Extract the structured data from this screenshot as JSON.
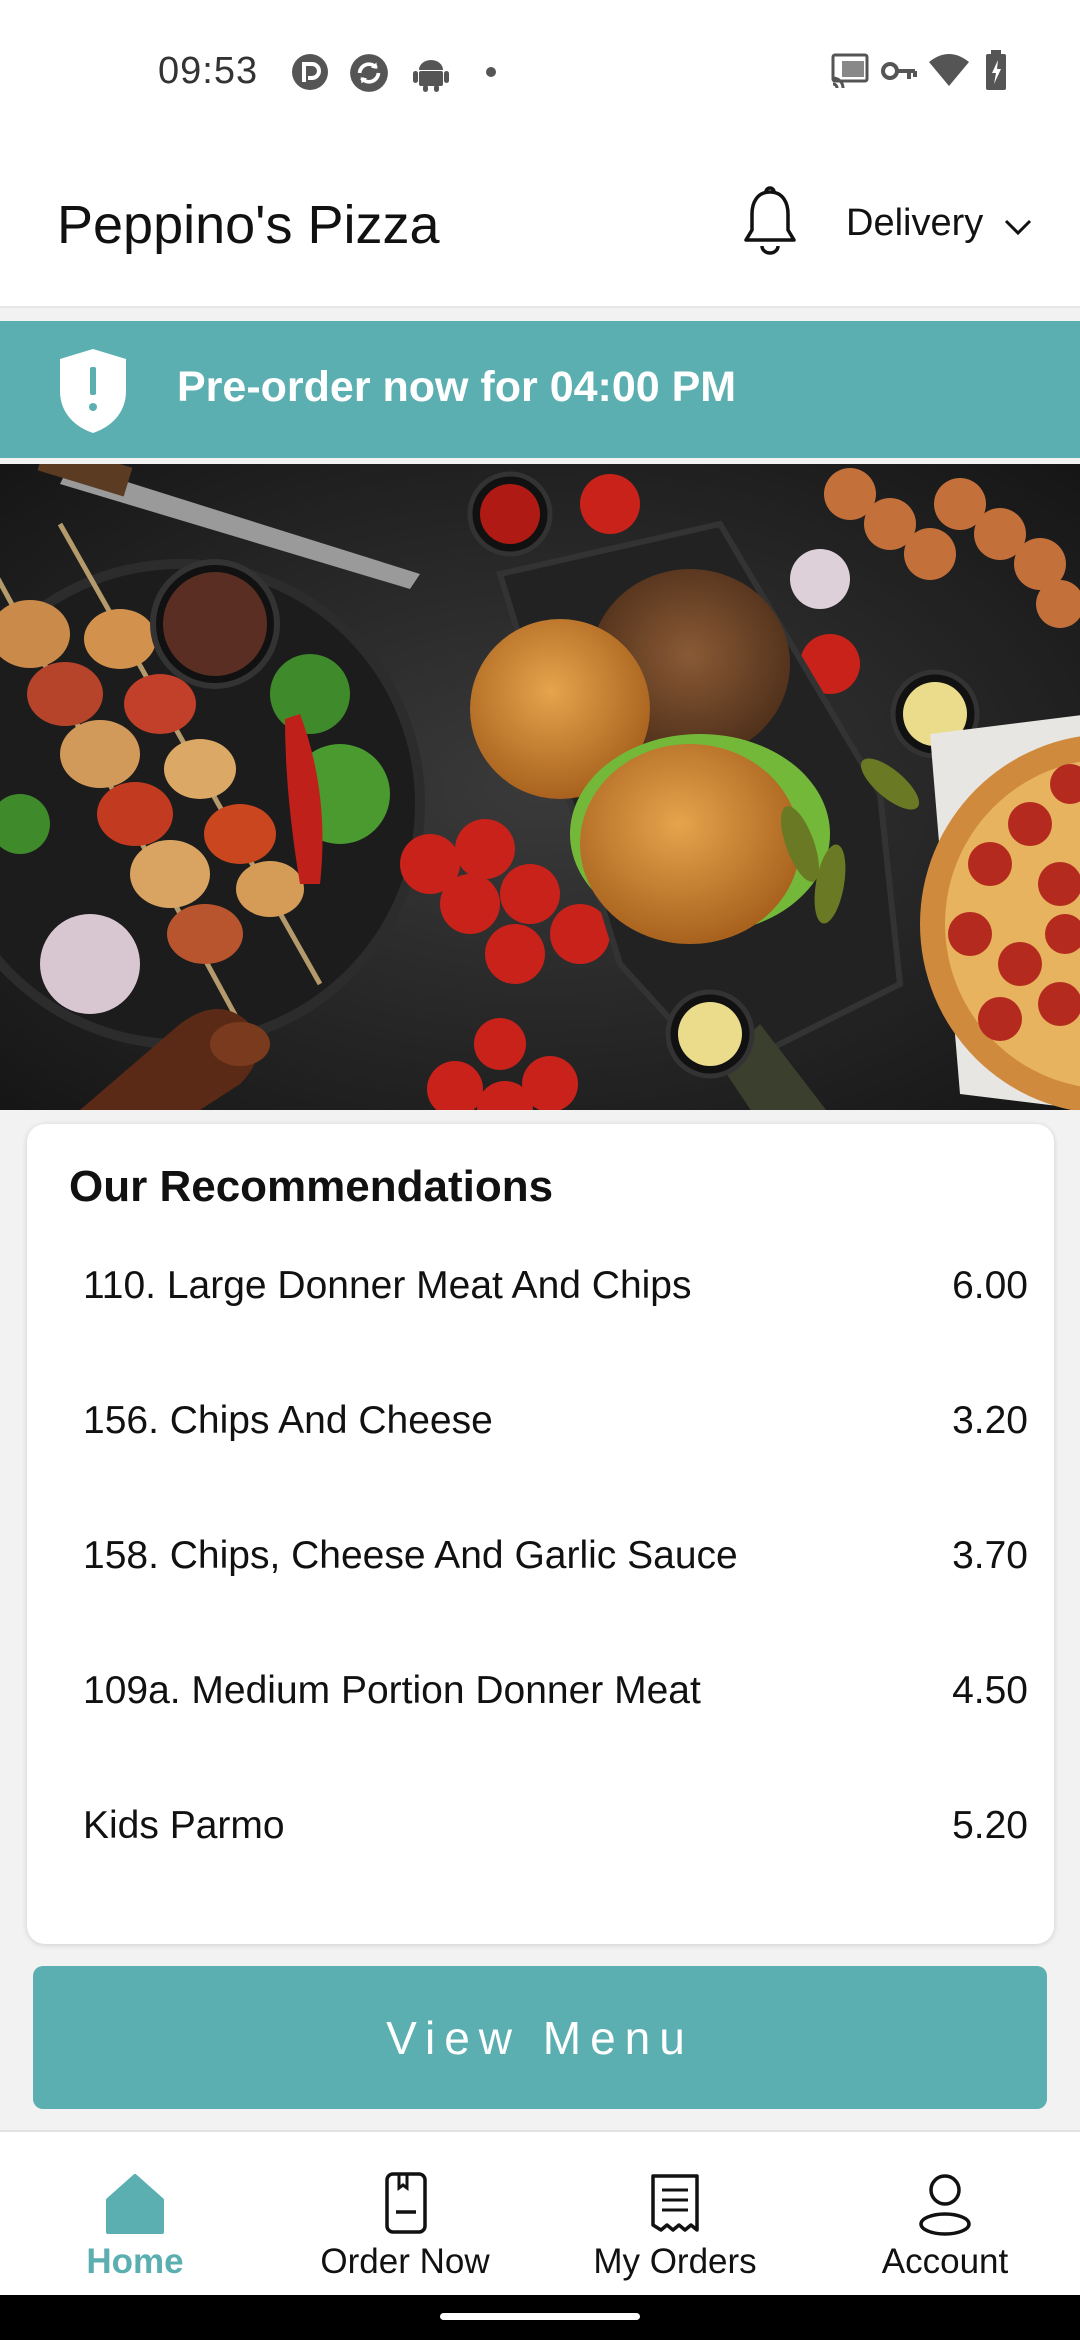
{
  "status_bar": {
    "time": "09:53",
    "left_icons": [
      "pocket-casts-icon",
      "sync-icon",
      "android-icon",
      "dot-icon"
    ],
    "right_icons": [
      "cast-icon",
      "vpn-key-icon",
      "wifi-icon",
      "battery-icon"
    ]
  },
  "header": {
    "title": "Peppino's Pizza",
    "notification_icon": "bell-icon",
    "order_type": "Delivery",
    "order_type_icon": "chevron-down-icon"
  },
  "banner": {
    "icon": "shield-alert-icon",
    "text": "Pre-order now for 04:00 PM"
  },
  "hero": {
    "image": "food-spread-image"
  },
  "recommendations": {
    "title": "Our Recommendations",
    "items": [
      {
        "name": "110. Large Donner Meat And Chips",
        "price": "6.00"
      },
      {
        "name": "156. Chips And Cheese",
        "price": "3.20"
      },
      {
        "name": "158. Chips, Cheese And Garlic Sauce",
        "price": "3.70"
      },
      {
        "name": "109a. Medium Portion Donner Meat",
        "price": "4.50"
      },
      {
        "name": "Kids Parmo",
        "price": "5.20"
      }
    ]
  },
  "view_menu_label": "View Menu",
  "nav": {
    "items": [
      {
        "label": "Home",
        "icon": "home-icon",
        "active": true
      },
      {
        "label": "Order Now",
        "icon": "order-now-icon",
        "active": false
      },
      {
        "label": "My Orders",
        "icon": "receipt-icon",
        "active": false
      },
      {
        "label": "Account",
        "icon": "account-icon",
        "active": false
      }
    ]
  },
  "colors": {
    "accent": "#5cafb1",
    "text": "#111111",
    "background": "#f2f2f2"
  }
}
